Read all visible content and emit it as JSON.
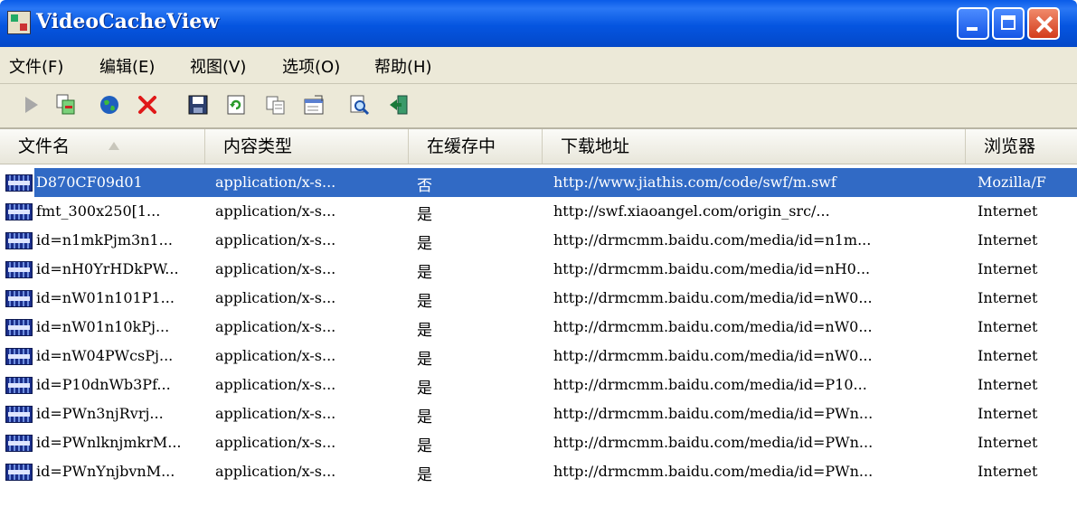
{
  "window": {
    "title": "VideoCacheView"
  },
  "menu": [
    "文件(F)",
    "编辑(E)",
    "视图(V)",
    "选项(O)",
    "帮助(H)"
  ],
  "toolbar_icons": [
    "play-icon",
    "copy-files-icon",
    "globe-icon",
    "delete-icon",
    "save-icon",
    "refresh-icon",
    "copy-icon",
    "properties-icon",
    "search-icon",
    "exit-icon"
  ],
  "columns": [
    "文件名",
    "内容类型",
    "在缓存中",
    "下载地址",
    "浏览器"
  ],
  "rows": [
    {
      "name": "D870CF09d01",
      "type": "application/x-s...",
      "cached": "否",
      "url": "http://www.jiathis.com/code/swf/m.swf",
      "browser": "Mozilla/F",
      "selected": true
    },
    {
      "name": "fmt_300x250[1...",
      "type": "application/x-s...",
      "cached": "是",
      "url": "http://swf.xiaoangel.com/origin_src/...",
      "browser": "Internet"
    },
    {
      "name": "id=n1mkPjm3n1...",
      "type": "application/x-s...",
      "cached": "是",
      "url": "http://drmcmm.baidu.com/media/id=n1m...",
      "browser": "Internet"
    },
    {
      "name": "id=nH0YrHDkPW...",
      "type": "application/x-s...",
      "cached": "是",
      "url": "http://drmcmm.baidu.com/media/id=nH0...",
      "browser": "Internet"
    },
    {
      "name": "id=nW01n101P1...",
      "type": "application/x-s...",
      "cached": "是",
      "url": "http://drmcmm.baidu.com/media/id=nW0...",
      "browser": "Internet"
    },
    {
      "name": "id=nW01n10kPj...",
      "type": "application/x-s...",
      "cached": "是",
      "url": "http://drmcmm.baidu.com/media/id=nW0...",
      "browser": "Internet"
    },
    {
      "name": "id=nW04PWcsPj...",
      "type": "application/x-s...",
      "cached": "是",
      "url": "http://drmcmm.baidu.com/media/id=nW0...",
      "browser": "Internet"
    },
    {
      "name": "id=P10dnWb3Pf...",
      "type": "application/x-s...",
      "cached": "是",
      "url": "http://drmcmm.baidu.com/media/id=P10...",
      "browser": "Internet"
    },
    {
      "name": "id=PWn3njRvrj...",
      "type": "application/x-s...",
      "cached": "是",
      "url": "http://drmcmm.baidu.com/media/id=PWn...",
      "browser": "Internet"
    },
    {
      "name": "id=PWnlknjmkrM...",
      "type": "application/x-s...",
      "cached": "是",
      "url": "http://drmcmm.baidu.com/media/id=PWn...",
      "browser": "Internet"
    },
    {
      "name": "id=PWnYnjbvnM...",
      "type": "application/x-s...",
      "cached": "是",
      "url": "http://drmcmm.baidu.com/media/id=PWn...",
      "browser": "Internet"
    }
  ]
}
